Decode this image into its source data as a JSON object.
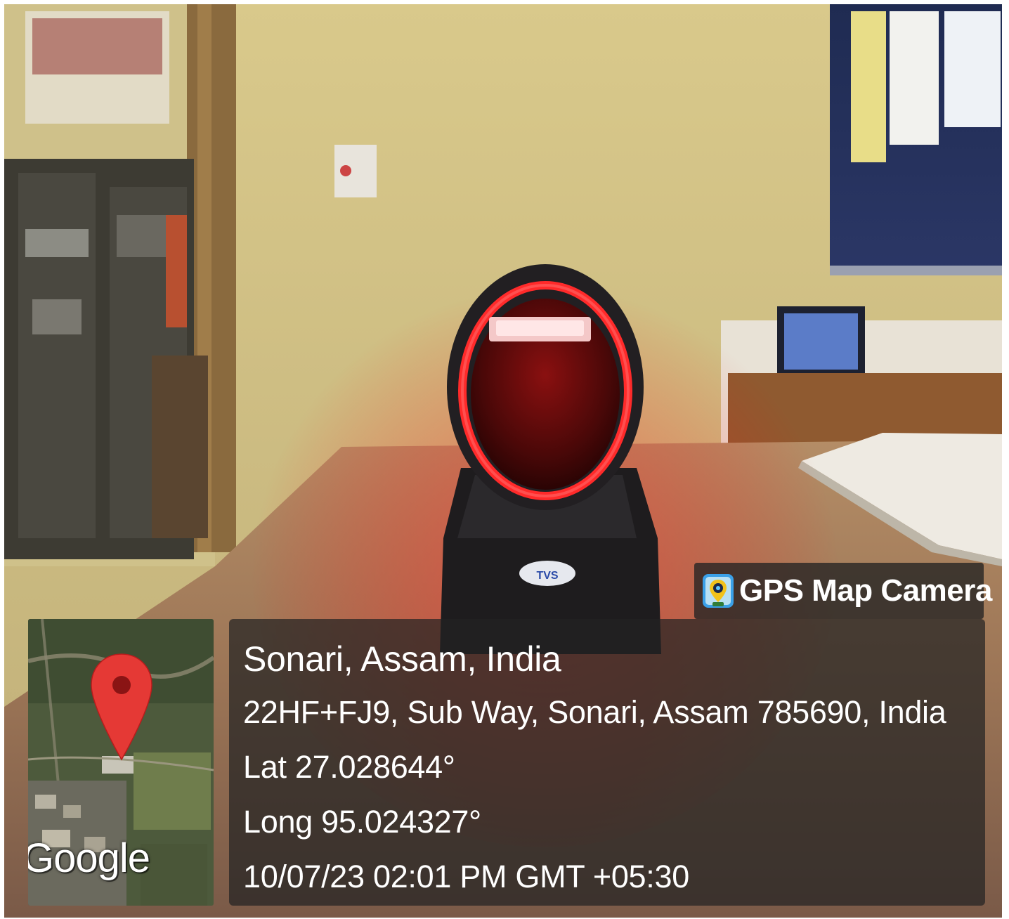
{
  "watermark": {
    "app_name": "GPS Map Camera",
    "icon": "gps-map-camera-icon"
  },
  "map": {
    "attribution": "Google",
    "marker_icon": "map-pin-icon",
    "pin_color": "#e53935"
  },
  "location": {
    "place": "Sonari, Assam, India",
    "address": "22HF+FJ9, Sub Way, Sonari, Assam 785690, India",
    "latitude": "Lat 27.028644°",
    "longitude": "Long 95.024327°",
    "timestamp": "10/07/23 02:01 PM GMT +05:30"
  },
  "photo": {
    "device_brand": "TVS",
    "accent_color": "#ff2a2a"
  }
}
